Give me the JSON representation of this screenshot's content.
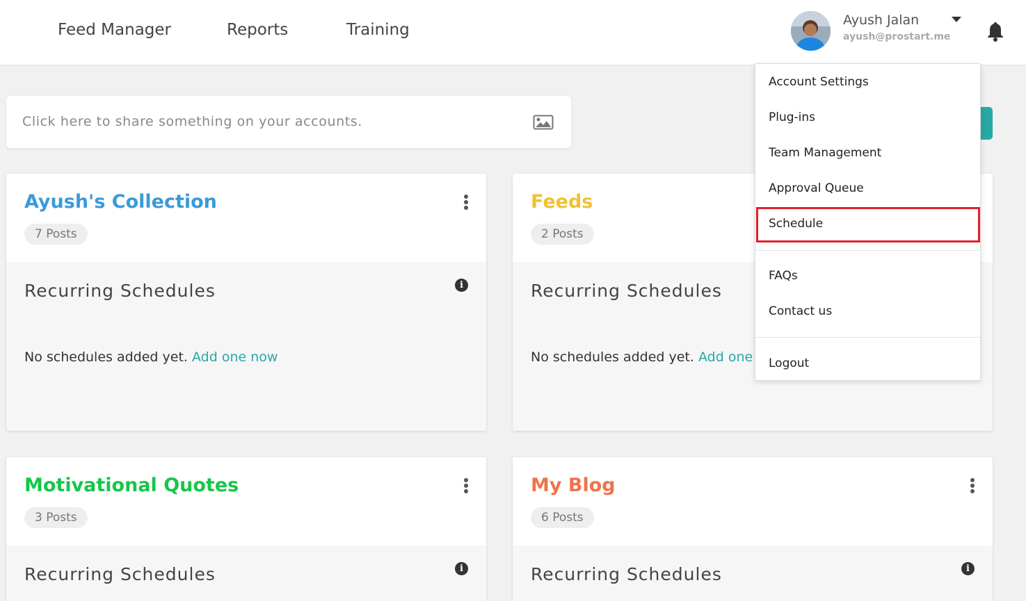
{
  "nav": {
    "feed_manager": "Feed Manager",
    "reports": "Reports",
    "training": "Training"
  },
  "user": {
    "name": "Ayush Jalan",
    "email": "ayush@prostart.me"
  },
  "share": {
    "placeholder": "Click here to share something on your accounts."
  },
  "cards": [
    {
      "title": "Ayush's Collection",
      "color": "#3b9ad9",
      "posts": "7 Posts",
      "section": "Recurring Schedules",
      "empty_text": "No schedules added yet.",
      "add_link": "Add one now"
    },
    {
      "title": "Feeds",
      "color": "#f2c12e",
      "posts": "2 Posts",
      "section": "Recurring Schedules",
      "empty_text": "No schedules added yet.",
      "add_link": "Add one now"
    },
    {
      "title": "Motivational Quotes",
      "color": "#16c64a",
      "posts": "3 Posts",
      "section": "Recurring Schedules"
    },
    {
      "title": "My Blog",
      "color": "#f0734a",
      "posts": "6 Posts",
      "section": "Recurring Schedules"
    }
  ],
  "dropdown": {
    "items": [
      "Account Settings",
      "Plug-ins",
      "Team Management",
      "Approval Queue",
      "Schedule",
      "FAQs",
      "Contact us",
      "Logout"
    ],
    "highlighted": "Schedule",
    "highlight_color": "#e02030"
  },
  "colors": {
    "accent": "#26a9a5"
  },
  "icons": {
    "bell": "bell-icon",
    "image": "image-icon",
    "info": "info-icon",
    "kebab": "kebab-menu-icon",
    "caret": "caret-down-icon"
  }
}
